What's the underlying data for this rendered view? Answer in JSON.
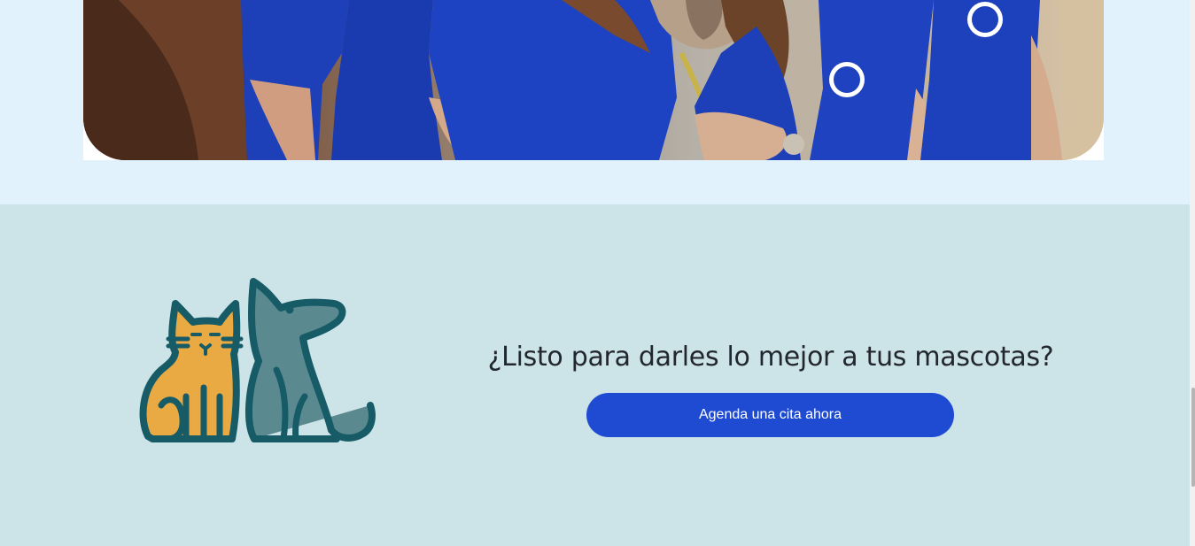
{
  "hero": {
    "image_alt": "Equipo veterinario con uniformes azules junto a un caballo"
  },
  "cta": {
    "title": "¿Listo para darles lo mejor a tus mascotas?",
    "button_label": "Agenda una cita ahora",
    "illustration": "cat-and-dog-icon"
  },
  "colors": {
    "page_bg": "#e2f2fc",
    "section_bg": "#cce3e8",
    "button_bg": "#1f4bd2",
    "title_color": "#22262d",
    "cat_fill": "#e9aa44",
    "dog_fill": "#5a8a90",
    "outline": "#165b66"
  }
}
